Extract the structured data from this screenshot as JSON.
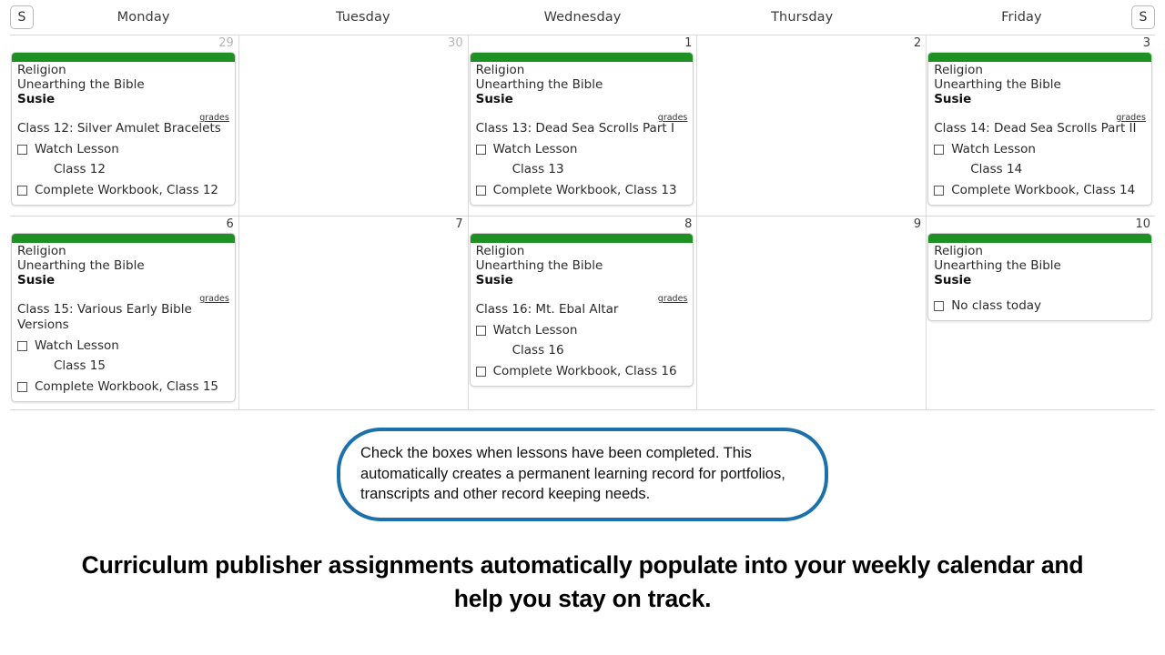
{
  "header": {
    "weekend_left_label": "S",
    "weekend_right_label": "S",
    "day_names": [
      "Monday",
      "Tuesday",
      "Wednesday",
      "Thursday",
      "Friday"
    ]
  },
  "labels": {
    "grades_link": "grades",
    "watch_lesson": "Watch Lesson",
    "no_class": "No class today"
  },
  "colors": {
    "card_accent_green": "#1f9023",
    "callout_border_blue": "#1c70ab",
    "grid_line": "#dcdcdc",
    "muted_daynum": "#b5b5b5"
  },
  "weeks": [
    {
      "days": [
        {
          "number": "29",
          "muted": true,
          "card": {
            "subject": "Religion",
            "course": "Unearthing the Bible",
            "student": "Susie",
            "grades": "grades",
            "lesson": "Class 12: Silver Amulet Bracelets",
            "task1": "Watch Lesson",
            "subtask": "Class 12",
            "task2": "Complete Workbook, Class 12"
          }
        },
        {
          "number": "30",
          "muted": true,
          "card": null
        },
        {
          "number": "1",
          "muted": false,
          "card": {
            "subject": "Religion",
            "course": "Unearthing the Bible",
            "student": "Susie",
            "grades": "grades",
            "lesson": "Class 13: Dead Sea Scrolls Part I",
            "task1": "Watch Lesson",
            "subtask": "Class 13",
            "task2": "Complete Workbook, Class 13"
          }
        },
        {
          "number": "2",
          "muted": false,
          "card": null
        },
        {
          "number": "3",
          "muted": false,
          "card": {
            "subject": "Religion",
            "course": "Unearthing the Bible",
            "student": "Susie",
            "grades": "grades",
            "lesson": "Class 14: Dead Sea Scrolls Part II",
            "task1": "Watch Lesson",
            "subtask": "Class 14",
            "task2": "Complete Workbook, Class 14"
          }
        }
      ]
    },
    {
      "days": [
        {
          "number": "6",
          "muted": false,
          "card": {
            "subject": "Religion",
            "course": "Unearthing the Bible",
            "student": "Susie",
            "grades": "grades",
            "lesson": "Class 15: Various Early Bible Versions",
            "task1": "Watch Lesson",
            "subtask": "Class 15",
            "task2": "Complete Workbook, Class 15"
          }
        },
        {
          "number": "7",
          "muted": false,
          "card": null
        },
        {
          "number": "8",
          "muted": false,
          "card": {
            "subject": "Religion",
            "course": "Unearthing the Bible",
            "student": "Susie",
            "grades": "grades",
            "lesson": "Class 16: Mt. Ebal Altar",
            "task1": "Watch Lesson",
            "subtask": "Class 16",
            "task2": "Complete Workbook, Class 16"
          }
        },
        {
          "number": "9",
          "muted": false,
          "card": null
        },
        {
          "number": "10",
          "muted": false,
          "card": {
            "subject": "Religion",
            "course": "Unearthing the Bible",
            "student": "Susie",
            "grades": null,
            "lesson": null,
            "task1": "No class today",
            "subtask": null,
            "task2": null
          }
        }
      ]
    }
  ],
  "callout": {
    "text": "Check the boxes when lessons have been completed. This automatically creates a permanent learning record for portfolios, transcripts and other record keeping needs."
  },
  "tagline": {
    "text": "Curriculum publisher assignments automatically populate into your weekly calendar and help you stay on track."
  }
}
